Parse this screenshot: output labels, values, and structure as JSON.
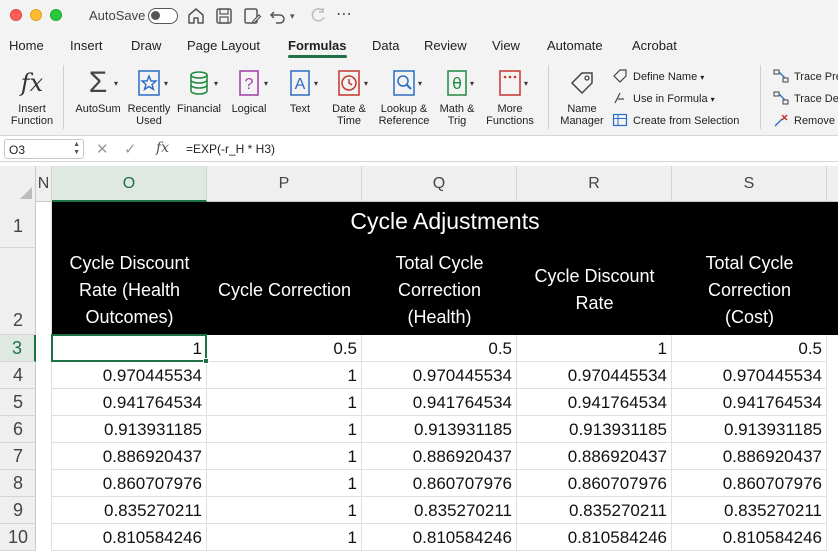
{
  "titlebar": {
    "autosave_label": "AutoSave"
  },
  "tabs": [
    "Home",
    "Insert",
    "Draw",
    "Page Layout",
    "Formulas",
    "Data",
    "Review",
    "View",
    "Automate",
    "Acrobat"
  ],
  "active_tab": "Formulas",
  "ribbon": {
    "insert_function": [
      "Insert",
      "Function"
    ],
    "autosum": "AutoSum",
    "recently_used": [
      "Recently",
      "Used"
    ],
    "financial": "Financial",
    "logical": "Logical",
    "text": "Text",
    "date_time": [
      "Date &",
      "Time"
    ],
    "lookup_reference": [
      "Lookup &",
      "Reference"
    ],
    "math_trig": [
      "Math &",
      "Trig"
    ],
    "more_functions": [
      "More",
      "Functions"
    ],
    "name_manager": [
      "Name",
      "Manager"
    ],
    "define_name": "Define Name",
    "use_in_formula": "Use in Formula",
    "create_from_selection": "Create from Selection",
    "trace_precedents": "Trace Pre",
    "trace_dependents": "Trace De",
    "remove_arrows": "Remove"
  },
  "formula_bar": {
    "name_box": "O3",
    "formula": "=EXP(-r_H * H3)"
  },
  "columns": [
    "N",
    "O",
    "P",
    "Q",
    "R",
    "S"
  ],
  "selected_column": "O",
  "rows": [
    "1",
    "2",
    "3",
    "4",
    "5",
    "6",
    "7",
    "8",
    "9",
    "10"
  ],
  "selected_row": "3",
  "sheet": {
    "band_title": "Cycle Adjustments",
    "headers": [
      [
        "Cycle Discount",
        "Rate (Health",
        "Outcomes)"
      ],
      [
        "Cycle Correction"
      ],
      [
        "Total Cycle",
        "Correction",
        "(Health)"
      ],
      [
        "Cycle Discount",
        "Rate"
      ],
      [
        "Total Cycle",
        "Correction",
        "(Cost)"
      ]
    ],
    "data": [
      [
        "1",
        "0.5",
        "0.5",
        "1",
        "0.5"
      ],
      [
        "0.970445534",
        "1",
        "0.970445534",
        "0.970445534",
        "0.970445534"
      ],
      [
        "0.941764534",
        "1",
        "0.941764534",
        "0.941764534",
        "0.941764534"
      ],
      [
        "0.913931185",
        "1",
        "0.913931185",
        "0.913931185",
        "0.913931185"
      ],
      [
        "0.886920437",
        "1",
        "0.886920437",
        "0.886920437",
        "0.886920437"
      ],
      [
        "0.860707976",
        "1",
        "0.860707976",
        "0.860707976",
        "0.860707976"
      ],
      [
        "0.835270211",
        "1",
        "0.835270211",
        "0.835270211",
        "0.835270211"
      ],
      [
        "0.810584246",
        "1",
        "0.810584246",
        "0.810584246",
        "0.810584246"
      ]
    ]
  },
  "colors": {
    "accent": "#1e7145",
    "header_band": "#000000"
  }
}
